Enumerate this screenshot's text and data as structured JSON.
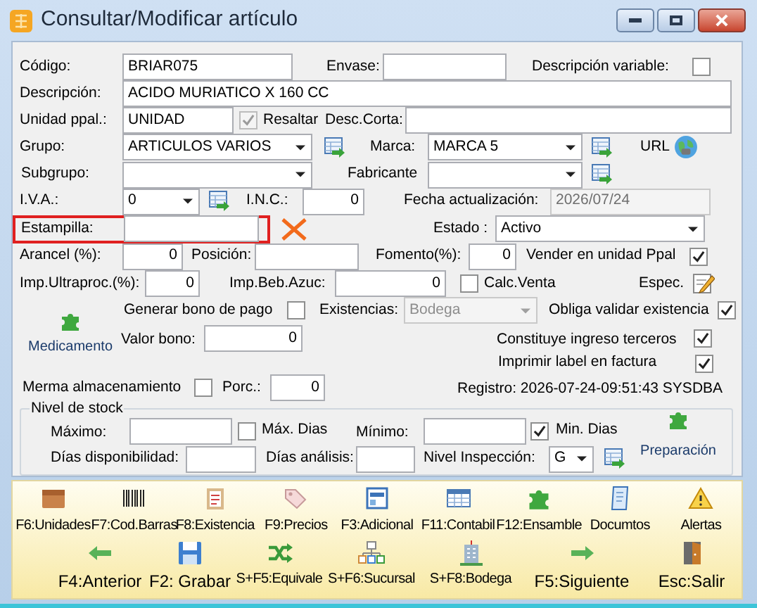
{
  "window": {
    "title": "Consultar/Modificar artículo"
  },
  "codigo": {
    "label": "Código:",
    "value": "BRIAR075"
  },
  "envase": {
    "label": "Envase:"
  },
  "descripcion_variable": {
    "label": "Descripción variable:",
    "checked": false
  },
  "descripcion": {
    "label": "Descripción:",
    "value": "ACIDO MURIATICO X 160 CC"
  },
  "unidad": {
    "label": "Unidad ppal.:",
    "value": "UNIDAD"
  },
  "resaltar": {
    "label": "Resaltar",
    "checked": true,
    "disabled": true
  },
  "desc_corta": {
    "label": "Desc.Corta:"
  },
  "grupo": {
    "label": "Grupo:",
    "value": "ARTICULOS VARIOS"
  },
  "marca": {
    "label": "Marca:",
    "value": "MARCA 5"
  },
  "url": {
    "label": "URL"
  },
  "subgrupo": {
    "label": "Subgrupo:"
  },
  "fabricante": {
    "label": "Fabricante"
  },
  "iva": {
    "label": "I.V.A.:",
    "value": "0"
  },
  "inc": {
    "label": "I.N.C.:",
    "value": "0"
  },
  "fecha": {
    "label": "Fecha actualización:",
    "value": "2026/07/24",
    "disabled": true
  },
  "estampilla": {
    "label": "Estampilla:",
    "error": true
  },
  "estado": {
    "label": "Estado :",
    "value": "Activo"
  },
  "arancel": {
    "label": "Arancel (%):",
    "value": "0"
  },
  "posicion": {
    "label": "Posición:"
  },
  "fomento": {
    "label": "Fomento(%):",
    "value": "0"
  },
  "vender": {
    "label": "Vender en unidad Ppal",
    "checked": true
  },
  "ultraproc": {
    "label": "Imp.Ultraproc.(%):",
    "value": "0"
  },
  "bebazuc": {
    "label": "Imp.Beb.Azuc:",
    "value": "0"
  },
  "calc_venta": {
    "label": "Calc.Venta",
    "checked": false
  },
  "espec": {
    "label": "Espec."
  },
  "generar_bono": {
    "label": "Generar bono de pago",
    "checked": false
  },
  "existencias": {
    "label": "Existencias:",
    "value": "Bodega",
    "disabled": true
  },
  "obliga": {
    "label": "Obliga validar existencia",
    "checked": true
  },
  "medicamento": {
    "label": "Medicamento"
  },
  "valor_bono": {
    "label": "Valor bono:",
    "value": "0"
  },
  "constituye": {
    "label": "Constituye ingreso terceros",
    "checked": true
  },
  "imprimir": {
    "label": "Imprimir label en factura",
    "checked": true
  },
  "merma": {
    "label": "Merma almacenamiento",
    "checked": false
  },
  "porc": {
    "label": "Porc.:",
    "value": "0"
  },
  "registro": "Registro: 2026-07-24-09:51:43 SYSDBA",
  "stock": {
    "legend": "Nivel de stock",
    "maximo": {
      "label": "Máximo:"
    },
    "max_dias": {
      "label": "Máx. Dias",
      "checked": false
    },
    "minimo": {
      "label": "Mínimo:"
    },
    "min_dias": {
      "label": "Min. Dias",
      "checked": true
    },
    "dias_disp": {
      "label": "Días disponibilidad:"
    },
    "dias_analisis": {
      "label": "Días análisis:"
    },
    "nivel": {
      "label": "Nivel Inspección:",
      "value": "G"
    },
    "preparacion": {
      "label": "Preparación"
    }
  },
  "toolbar_top": [
    {
      "label": "F6:Unidades",
      "kind": "box"
    },
    {
      "label": "F7:Cod.Barras",
      "kind": "barcode"
    },
    {
      "label": "F8:Existencia",
      "kind": "clipboard"
    },
    {
      "label": "F9:Precios",
      "kind": "tag"
    },
    {
      "label": "F3:Adicional",
      "kind": "layout"
    },
    {
      "label": "F11:Contabil",
      "kind": "table"
    },
    {
      "label": "F12:Ensamble",
      "kind": "puzzle"
    },
    {
      "label": "Documtos",
      "kind": "document"
    },
    {
      "label": "Alertas",
      "kind": "warning"
    }
  ],
  "toolbar_bottom": [
    {
      "label": "F4:Anterior",
      "kind": "back",
      "prominent": true
    },
    {
      "label": "F2: Grabar",
      "kind": "save",
      "prominent": true
    },
    {
      "label": "S+F5:Equivale",
      "kind": "shuffle",
      "prominent": false
    },
    {
      "label": "S+F6:Sucursal",
      "kind": "branches",
      "prominent": false
    },
    {
      "label": "S+F8:Bodega",
      "kind": "building",
      "prominent": false
    },
    {
      "label": "F5:Siguiente",
      "kind": "forward",
      "prominent": true
    },
    {
      "label": "Esc:Salir",
      "kind": "door",
      "prominent": true
    }
  ]
}
